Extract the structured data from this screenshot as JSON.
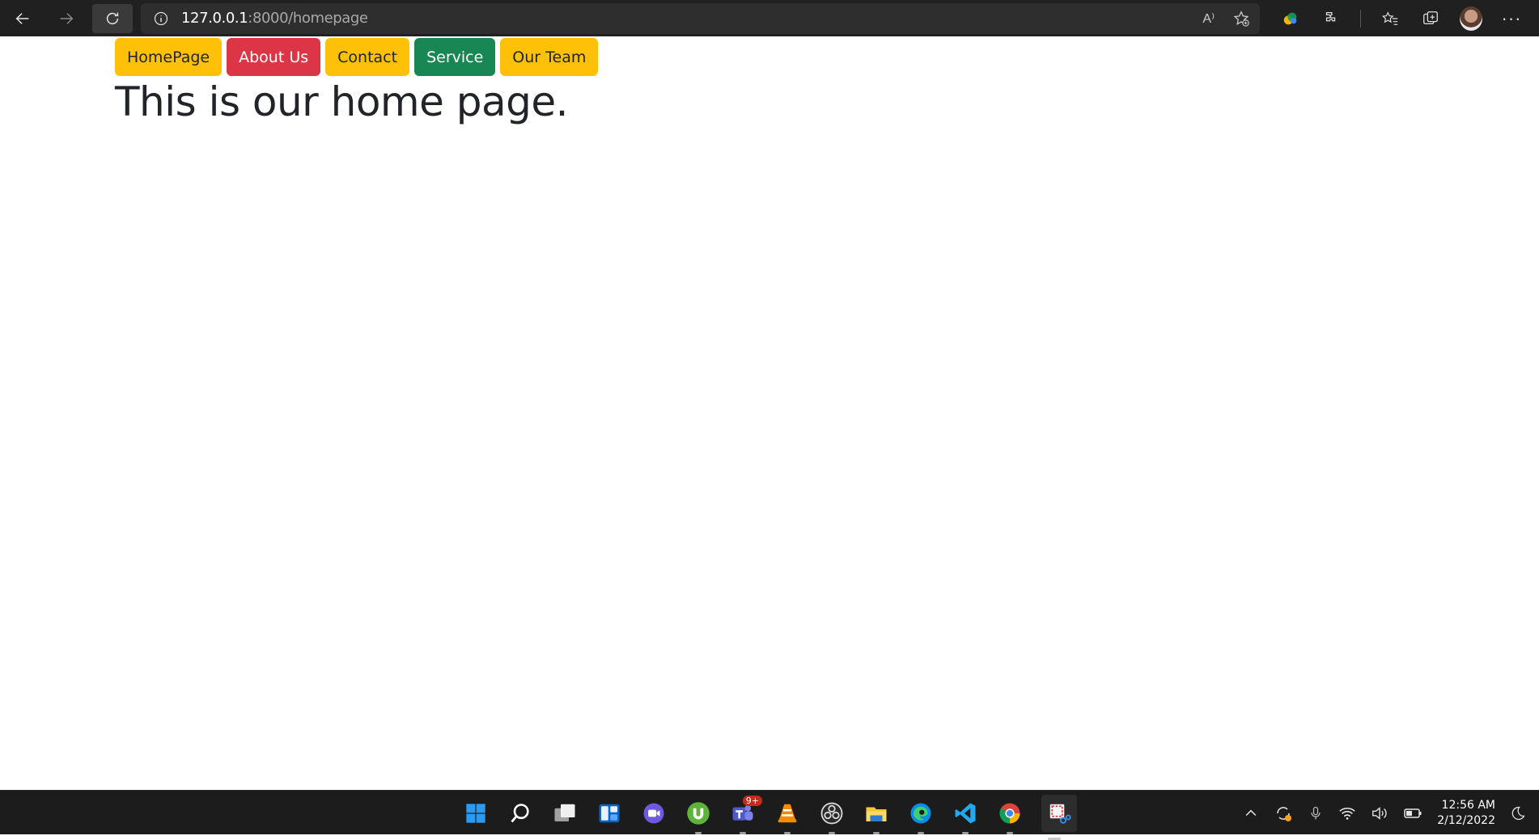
{
  "browser": {
    "url_host": "127.0.0.1",
    "url_rest": ":8000/homepage",
    "read_aloud_label": "A⁾"
  },
  "nav_buttons": [
    {
      "label": "HomePage",
      "color": "#ffc107"
    },
    {
      "label": "About Us",
      "color": "#dc3545"
    },
    {
      "label": "Contact",
      "color": "#ffc107"
    },
    {
      "label": "Service",
      "color": "#198754"
    },
    {
      "label": "Our Team",
      "color": "#ffc107"
    }
  ],
  "heading": "This is our home page.",
  "taskbar": {
    "apps": [
      "start-icon",
      "search-icon",
      "task-view-icon",
      "widgets-icon",
      "chat-icon",
      "utorrent-icon",
      "teams-icon",
      "vlc-icon",
      "obs-icon",
      "file-explorer-icon",
      "edge-icon",
      "vscode-icon",
      "chrome-icon",
      "snipping-tool-icon"
    ],
    "teams_badge": "9+",
    "time": "12:56 AM",
    "date": "2/12/2022"
  }
}
